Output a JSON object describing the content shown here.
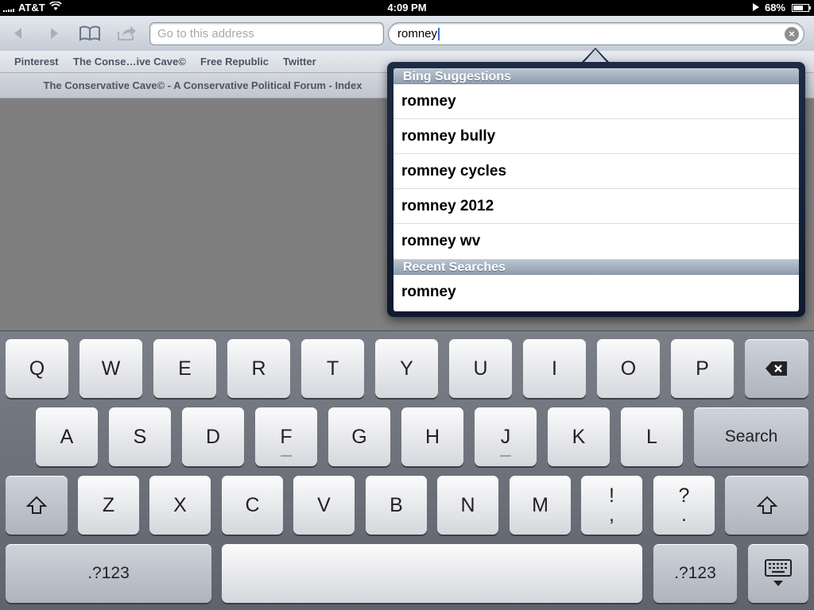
{
  "status_bar": {
    "carrier": "AT&T",
    "time": "4:09 PM",
    "battery_percent": "68%",
    "battery_level": 0.68
  },
  "toolbar": {
    "address_placeholder": "Go to this address",
    "search_value": "romney",
    "clear_icon": "x-circle-icon"
  },
  "bookmarks": [
    {
      "label": "Pinterest"
    },
    {
      "label": "The Conse…ive Cave©"
    },
    {
      "label": "Free Republic"
    },
    {
      "label": "Twitter"
    }
  ],
  "page": {
    "title": "The Conservative Cave© - A Conservative Political Forum - Index"
  },
  "suggestions": {
    "bing_header": "Bing Suggestions",
    "bing_items": [
      "romney",
      "romney bully",
      "romney cycles",
      "romney 2012",
      "romney wv"
    ],
    "recent_header": "Recent Searches",
    "recent_items": [
      "romney"
    ]
  },
  "keyboard": {
    "row1": [
      "Q",
      "W",
      "E",
      "R",
      "T",
      "Y",
      "U",
      "I",
      "O",
      "P"
    ],
    "row2": [
      "A",
      "S",
      "D",
      "F",
      "G",
      "H",
      "J",
      "K",
      "L"
    ],
    "row3": [
      "Z",
      "X",
      "C",
      "V",
      "B",
      "N",
      "M"
    ],
    "search_key": "Search",
    "punct_1_top": "!",
    "punct_1_bottom": ",",
    "punct_2_top": "?",
    "punct_2_bottom": ".",
    "numbers_left": ".?123",
    "numbers_right": ".?123"
  }
}
